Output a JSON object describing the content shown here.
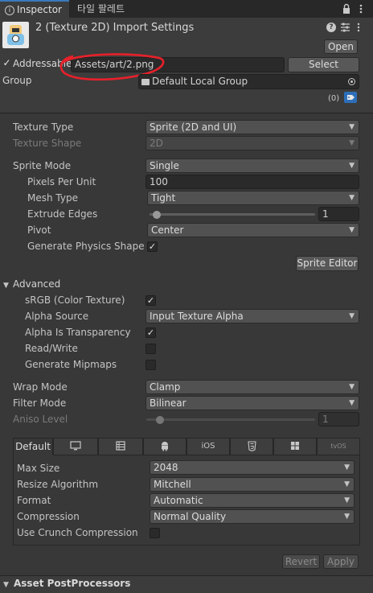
{
  "tabs": {
    "inspector": "Inspector",
    "tile_palette": "타일 팔레트"
  },
  "header": {
    "title": "2 (Texture 2D) Import Settings",
    "open_label": "Open",
    "addressable_label": "Addressable",
    "addressable_checked": true,
    "address_value": "Assets/art/2.png",
    "select_label": "Select",
    "group_label": "Group",
    "group_value": "Default Local Group",
    "label_count": "(0)"
  },
  "settings": {
    "texture_type": {
      "label": "Texture Type",
      "value": "Sprite (2D and UI)"
    },
    "texture_shape": {
      "label": "Texture Shape",
      "value": "2D"
    },
    "sprite_mode": {
      "label": "Sprite Mode",
      "value": "Single"
    },
    "pixels_per_unit": {
      "label": "Pixels Per Unit",
      "value": "100"
    },
    "mesh_type": {
      "label": "Mesh Type",
      "value": "Tight"
    },
    "extrude_edges": {
      "label": "Extrude Edges",
      "value": "1"
    },
    "pivot": {
      "label": "Pivot",
      "value": "Center"
    },
    "generate_physics_shape": {
      "label": "Generate Physics Shape",
      "checked": true
    },
    "sprite_editor_label": "Sprite Editor"
  },
  "advanced": {
    "label": "Advanced",
    "srgb": {
      "label": "sRGB (Color Texture)",
      "checked": true
    },
    "alpha_source": {
      "label": "Alpha Source",
      "value": "Input Texture Alpha"
    },
    "alpha_is_transparency": {
      "label": "Alpha Is Transparency",
      "checked": true
    },
    "read_write": {
      "label": "Read/Write",
      "checked": false
    },
    "generate_mipmaps": {
      "label": "Generate Mipmaps",
      "checked": false
    }
  },
  "wrap_mode": {
    "label": "Wrap Mode",
    "value": "Clamp"
  },
  "filter_mode": {
    "label": "Filter Mode",
    "value": "Bilinear"
  },
  "aniso_level": {
    "label": "Aniso Level",
    "value": "1"
  },
  "platform_tabs": [
    "Default",
    "standalone-icon",
    "webgl-icon",
    "android-icon",
    "iOS",
    "html5-icon",
    "windows-icon",
    "tvOS"
  ],
  "platform": {
    "max_size": {
      "label": "Max Size",
      "value": "2048"
    },
    "resize_algorithm": {
      "label": "Resize Algorithm",
      "value": "Mitchell"
    },
    "format": {
      "label": "Format",
      "value": "Automatic"
    },
    "compression": {
      "label": "Compression",
      "value": "Normal Quality"
    },
    "use_crunch_compression": {
      "label": "Use Crunch Compression",
      "checked": false
    }
  },
  "footer": {
    "revert_label": "Revert",
    "apply_label": "Apply"
  },
  "asset_postprocessors": "Asset PostProcessors",
  "colors": {
    "annotation_red": "#e8202a",
    "accent_blue": "#3a79bb",
    "background": "#383838"
  }
}
